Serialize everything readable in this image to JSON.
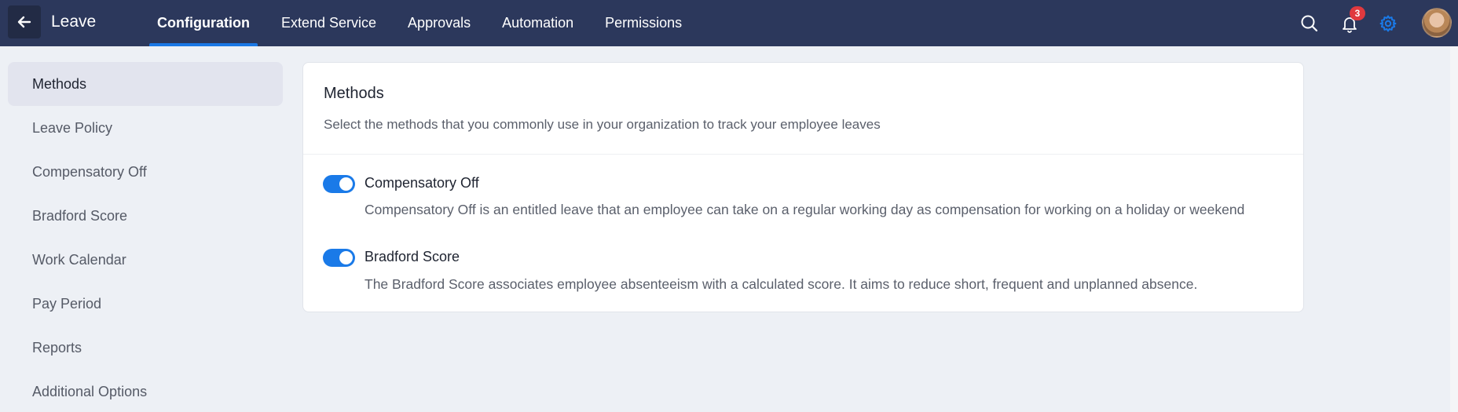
{
  "header": {
    "app_title": "Leave",
    "tabs": [
      {
        "label": "Configuration"
      },
      {
        "label": "Extend Service"
      },
      {
        "label": "Approvals"
      },
      {
        "label": "Automation"
      },
      {
        "label": "Permissions"
      }
    ],
    "active_tab": "Configuration",
    "notification_count": "3",
    "accent_color": "#1a78e5",
    "header_bg": "#2c385c",
    "icons": [
      "back-arrow-icon",
      "search-icon",
      "bell-icon",
      "gear-icon",
      "avatar"
    ]
  },
  "sidebar": {
    "items": [
      {
        "label": "Methods"
      },
      {
        "label": "Leave Policy"
      },
      {
        "label": "Compensatory Off"
      },
      {
        "label": "Bradford Score"
      },
      {
        "label": "Work Calendar"
      },
      {
        "label": "Pay Period"
      },
      {
        "label": "Reports"
      },
      {
        "label": "Additional Options"
      }
    ],
    "active_item": "Methods"
  },
  "main": {
    "title": "Methods",
    "description": "Select the methods that you commonly use in your organization to track your employee leaves",
    "options": [
      {
        "title": "Compensatory Off",
        "description": "Compensatory Off is an entitled leave that an employee can take on a regular working day as compensation for working on a holiday or weekend",
        "enabled": true
      },
      {
        "title": "Bradford Score",
        "description": "The Bradford Score associates employee absenteeism with a calculated score. It aims to reduce short, frequent and unplanned absence.",
        "enabled": true
      }
    ]
  }
}
